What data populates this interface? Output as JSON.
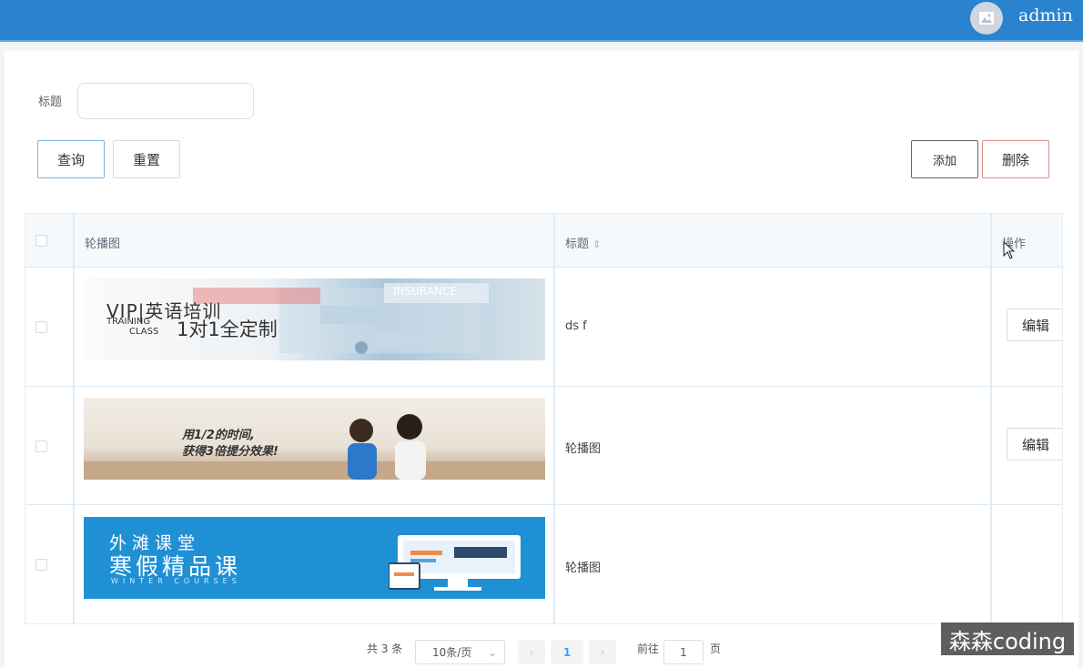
{
  "header": {
    "username": "admin"
  },
  "search": {
    "label": "标题",
    "value": ""
  },
  "buttons": {
    "query": "查询",
    "reset": "重置",
    "add": "添加",
    "delete": "删除"
  },
  "table": {
    "columns": [
      "轮播图",
      "标题",
      "操作"
    ],
    "rows": [
      {
        "title": "ds f",
        "action": "编辑",
        "banner": {
          "line1": "VIP|英语培训",
          "line2": "1对1全定制",
          "tag1": "TRAINING",
          "tag2": "CLASS",
          "tag3": "INSURANCE"
        }
      },
      {
        "title": "轮播图",
        "action": "编辑",
        "banner": {
          "line1": "用1/2的时间,",
          "line2": "获得3倍提分效果!"
        }
      },
      {
        "title": "轮播图",
        "action": "",
        "banner": {
          "line1": "外滩课堂",
          "line2": "寒假精品课",
          "line3": "WINTER COURSES"
        }
      }
    ]
  },
  "pagination": {
    "total": "共 3 条",
    "page_size": "10条/页",
    "current_page": "1",
    "goto_label": "前往",
    "goto_value": "1",
    "goto_suffix": "页"
  },
  "watermark": "森森coding",
  "colors": {
    "topbar": "#2a83cf",
    "banner3": "#2090d5"
  }
}
